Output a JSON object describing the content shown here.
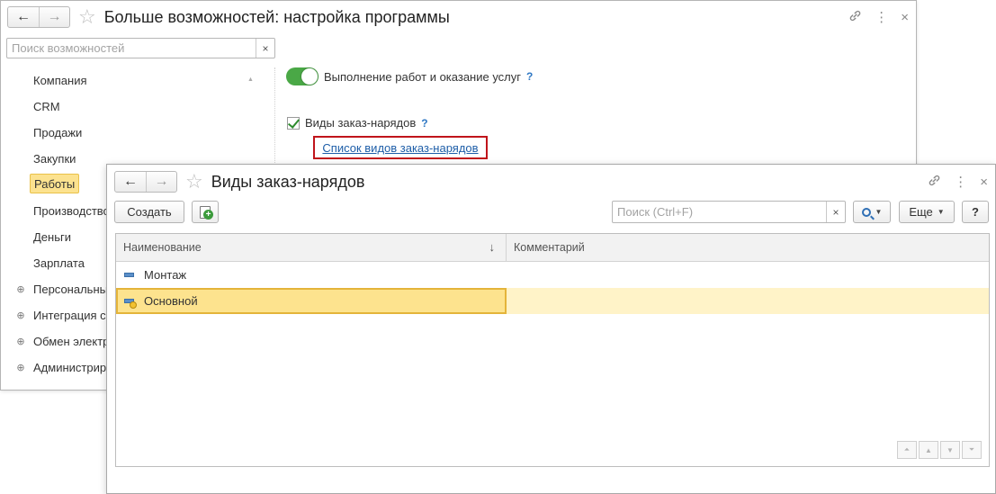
{
  "back_window": {
    "title": "Больше возможностей: настройка программы",
    "back_arrow": "←",
    "forward_arrow": "→",
    "star": "☆",
    "link_tool": "🔗",
    "more_tool": "⋮",
    "close_tool": "×",
    "search": {
      "placeholder": "Поиск возможностей",
      "clear": "×"
    },
    "sidebar": {
      "items": [
        {
          "label": "Компания",
          "expandable": false
        },
        {
          "label": "CRM",
          "expandable": false
        },
        {
          "label": "Продажи",
          "expandable": false
        },
        {
          "label": "Закупки",
          "expandable": false
        },
        {
          "label": "Работы",
          "expandable": false,
          "active": true
        },
        {
          "label": "Производство",
          "expandable": false
        },
        {
          "label": "Деньги",
          "expandable": false
        },
        {
          "label": "Зарплата",
          "expandable": false
        },
        {
          "label": "Персональны",
          "expandable": true
        },
        {
          "label": "Интеграция с",
          "expandable": true
        },
        {
          "label": "Обмен электр",
          "expandable": true
        },
        {
          "label": "Администриро",
          "expandable": true
        }
      ],
      "expand_glyph": "⊕",
      "scroll_up_glyph": "▲"
    },
    "options": {
      "toggle_label": "Выполнение работ и оказание услуг",
      "checkbox_label": "Виды заказ-нарядов",
      "help": "?",
      "link": "Список видов заказ-нарядов"
    }
  },
  "front_window": {
    "title": "Виды заказ-нарядов",
    "back_arrow": "←",
    "forward_arrow": "→",
    "star": "☆",
    "link_tool": "🔗",
    "more_tool": "⋮",
    "close_tool": "×",
    "toolbar": {
      "create_label": "Создать",
      "search_placeholder": "Поиск (Ctrl+F)",
      "search_clear": "×",
      "more_label": "Еще",
      "help_label": "?",
      "caret": "▼"
    },
    "table": {
      "columns": [
        "Наименование",
        "Комментарий"
      ],
      "sort_arrow": "↓",
      "rows": [
        {
          "name": "Монтаж",
          "comment": "",
          "selected": false,
          "main": false
        },
        {
          "name": "Основной",
          "comment": "",
          "selected": true,
          "main": true
        }
      ]
    },
    "pager": [
      "⏫",
      "▲",
      "▼",
      "⏬"
    ]
  },
  "colors": {
    "accent_green": "#4aa846",
    "link_blue": "#1e5ea8",
    "highlight_red": "#c0141b",
    "selection_yellow": "#fde38e"
  }
}
